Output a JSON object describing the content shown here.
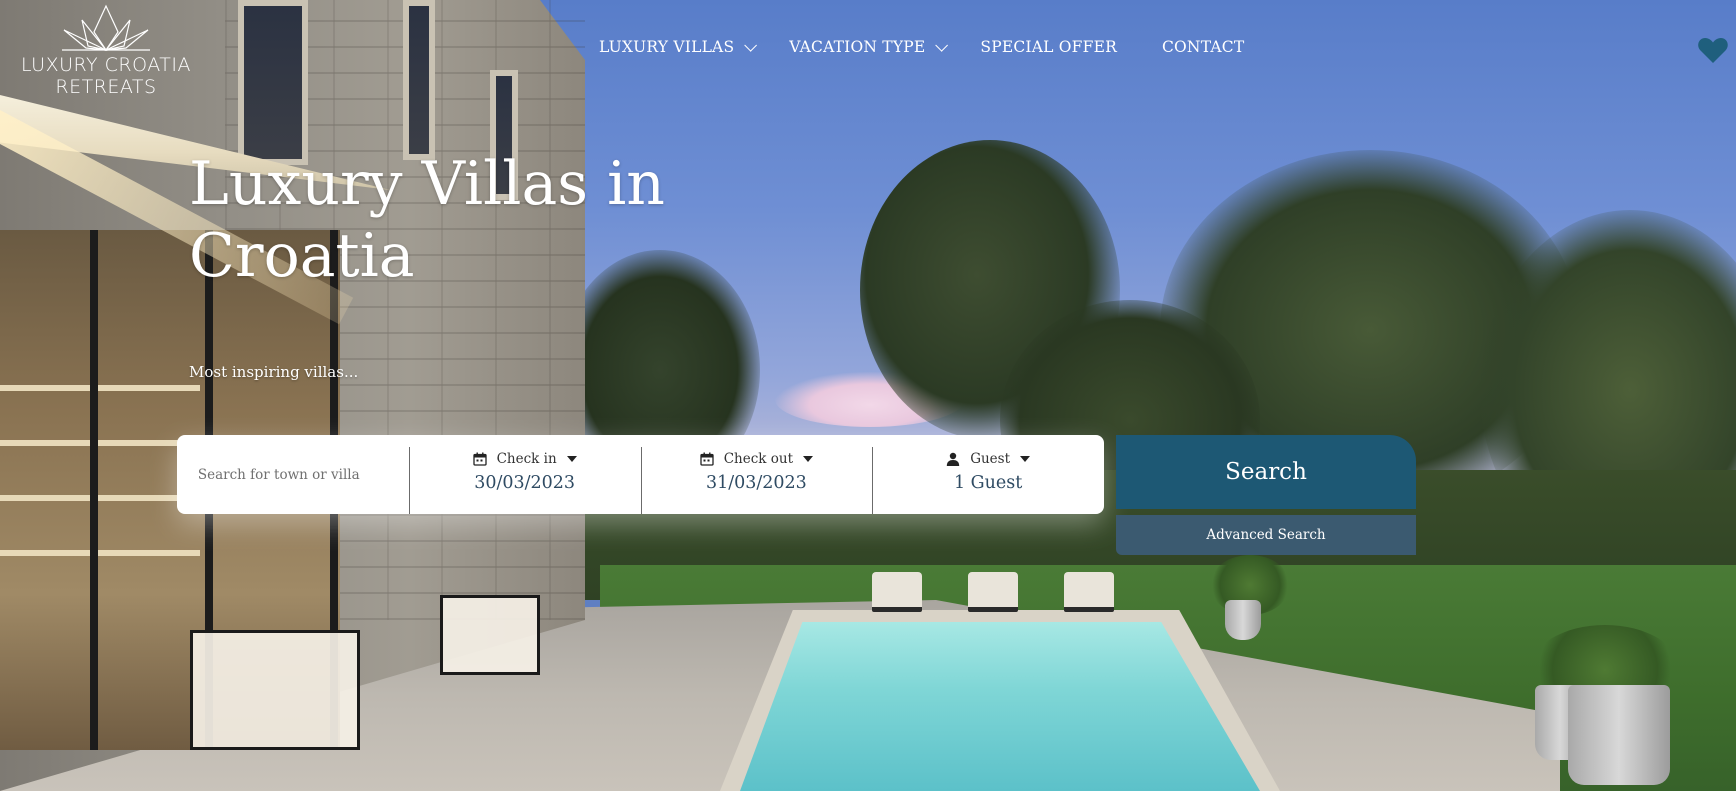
{
  "brand": {
    "logo_line1": "LUXURY CROATIA",
    "logo_line2": "RETREATS",
    "accent_color": "#1d5874",
    "heart_color": "#1f5f7d"
  },
  "nav": {
    "items": [
      {
        "label": "LUXURY VILLAS",
        "has_dropdown": true
      },
      {
        "label": "VACATION TYPE",
        "has_dropdown": true
      },
      {
        "label": "SPECIAL OFFER",
        "has_dropdown": false
      },
      {
        "label": "CONTACT",
        "has_dropdown": false
      }
    ],
    "favorites_icon": "heart-icon"
  },
  "hero": {
    "title": "Luxury Villas in Croatia",
    "subtitle": "Most inspiring villas..."
  },
  "search": {
    "placeholder": "Search for town or villa",
    "check_in_label": "Check in",
    "check_in_value": "30/03/2023",
    "check_out_label": "Check out",
    "check_out_value": "31/03/2023",
    "guest_label": "Guest",
    "guest_value": "1 Guest",
    "search_label": "Search",
    "advanced_label": "Advanced Search"
  }
}
